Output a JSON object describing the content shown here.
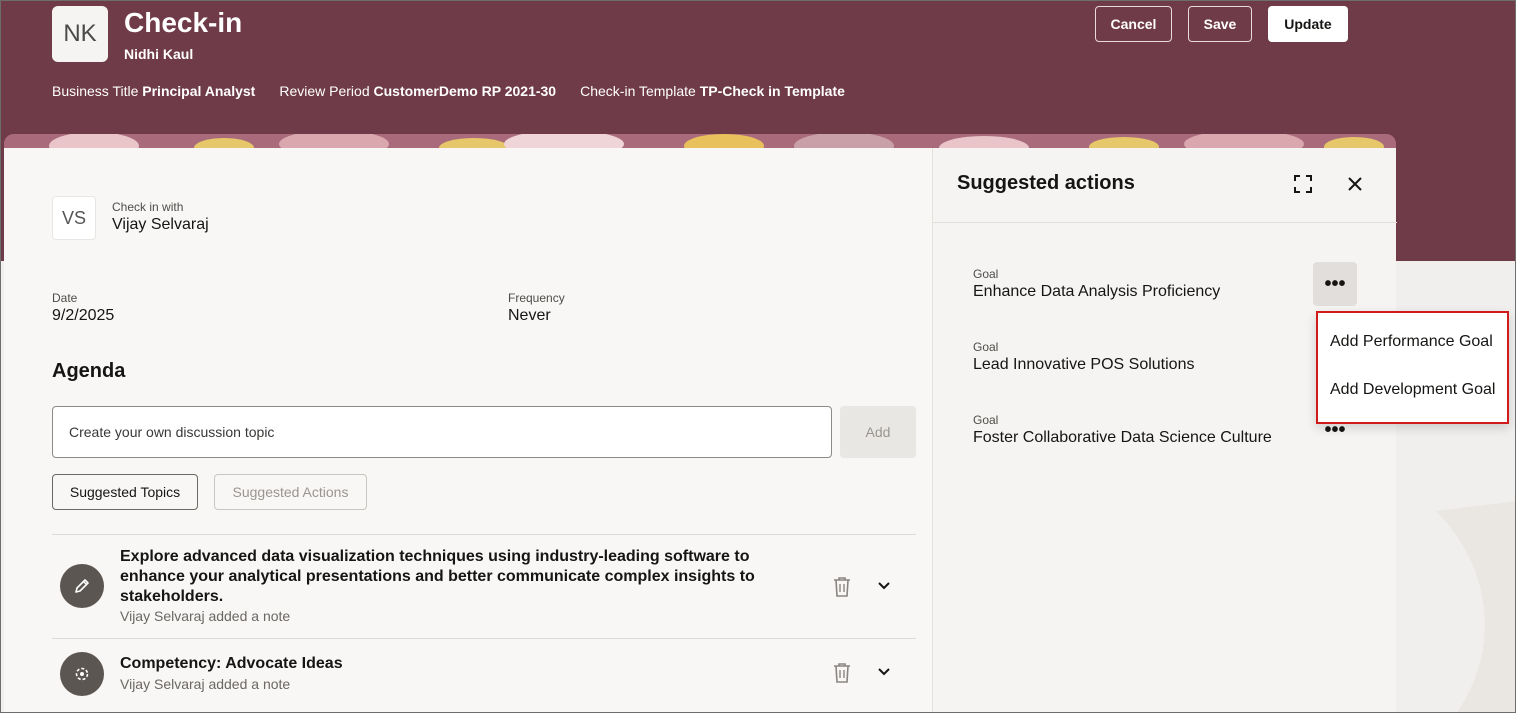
{
  "header": {
    "avatar_initials": "NK",
    "title": "Check-in",
    "subtitle": "Nidhi Kaul",
    "meta": [
      {
        "label": "Business Title",
        "value": "Principal Analyst"
      },
      {
        "label": "Review Period",
        "value": "CustomerDemo RP 2021-30"
      },
      {
        "label": "Check-in Template",
        "value": "TP-Check in Template"
      }
    ],
    "buttons": {
      "cancel": "Cancel",
      "save": "Save",
      "update": "Update"
    },
    "bg_color": "#6f3b48"
  },
  "checkin": {
    "avatar_initials": "VS",
    "label": "Check in with",
    "name": "Vijay Selvaraj"
  },
  "fields": {
    "date_label": "Date",
    "date_value": "9/2/2025",
    "frequency_label": "Frequency",
    "frequency_value": "Never"
  },
  "agenda": {
    "title": "Agenda",
    "input_placeholder": "Create your own discussion topic",
    "add_label": "Add",
    "tabs": {
      "suggested_topics": "Suggested Topics",
      "suggested_actions": "Suggested Actions"
    },
    "items": [
      {
        "title": "Explore advanced data visualization techniques using industry-leading software to enhance your analytical presentations and better communicate complex insights to stakeholders.",
        "subtitle": "Vijay Selvaraj added a note",
        "icon": "pencil-icon"
      },
      {
        "title": "Competency: Advocate Ideas",
        "subtitle": "Vijay Selvaraj added a note",
        "icon": "competency-icon"
      }
    ]
  },
  "suggested_actions": {
    "title": "Suggested actions",
    "goals": [
      {
        "label": "Goal",
        "title": "Enhance Data Analysis Proficiency"
      },
      {
        "label": "Goal",
        "title": "Lead Innovative POS Solutions"
      },
      {
        "label": "Goal",
        "title": "Foster Collaborative Data Science Culture"
      }
    ],
    "more_label": "•••",
    "menu": [
      "Add Performance Goal",
      "Add Development Goal"
    ]
  }
}
